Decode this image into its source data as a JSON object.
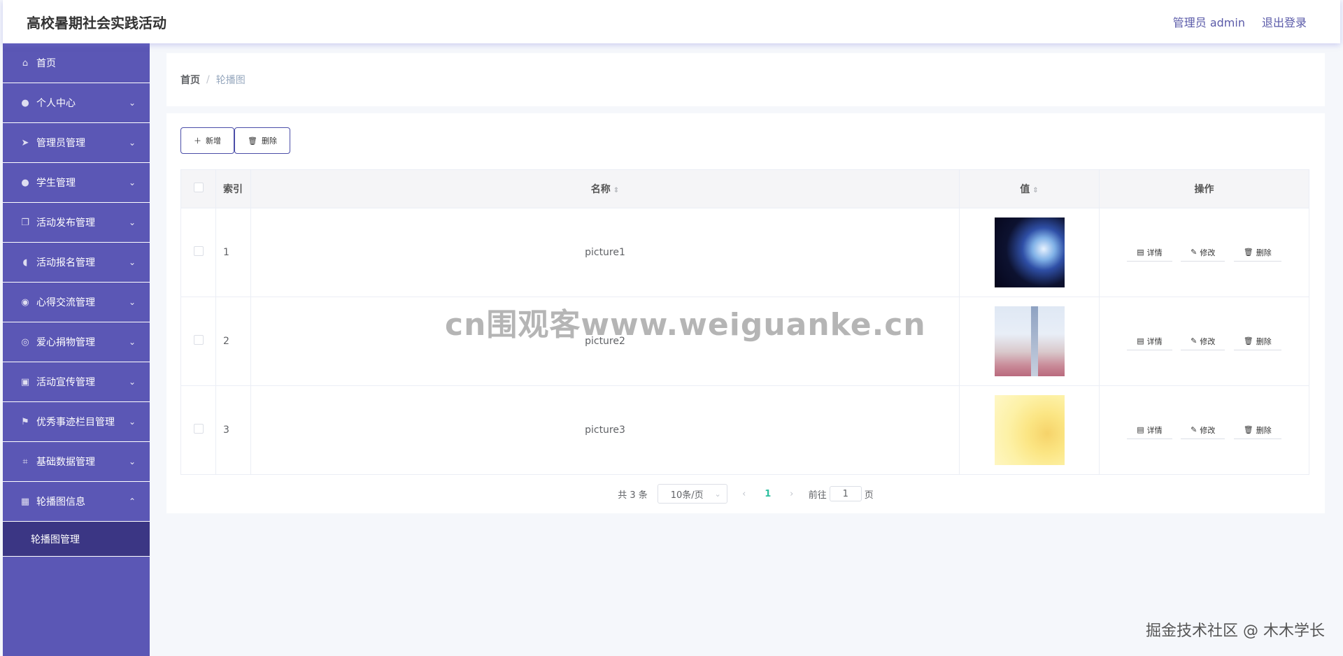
{
  "header": {
    "title": "高校暑期社会实践活动",
    "user_label": "管理员 admin",
    "logout_label": "退出登录"
  },
  "sidebar": {
    "items": [
      {
        "label": "首页",
        "icon": "home-icon"
      },
      {
        "label": "个人中心",
        "icon": "user-icon"
      },
      {
        "label": "管理员管理",
        "icon": "send-icon"
      },
      {
        "label": "学生管理",
        "icon": "user-icon"
      },
      {
        "label": "活动发布管理",
        "icon": "copy-icon"
      },
      {
        "label": "活动报名管理",
        "icon": "microphone-icon"
      },
      {
        "label": "心得交流管理",
        "icon": "location-icon"
      },
      {
        "label": "爱心捐物管理",
        "icon": "gift-icon"
      },
      {
        "label": "活动宣传管理",
        "icon": "picture-icon"
      },
      {
        "label": "优秀事迹栏目管理",
        "icon": "flag-icon"
      },
      {
        "label": "基础数据管理",
        "icon": "crop-icon"
      },
      {
        "label": "轮播图信息",
        "icon": "grid-icon"
      }
    ],
    "submenu": {
      "label": "轮播图管理"
    }
  },
  "breadcrumb": {
    "home": "首页",
    "separator": "/",
    "current": "轮播图"
  },
  "toolbar": {
    "add_label": "新增",
    "delete_label": "删除"
  },
  "table": {
    "headers": {
      "index": "索引",
      "name": "名称",
      "value": "值",
      "ops": "操作"
    },
    "rows": [
      {
        "index": "1",
        "name": "picture1"
      },
      {
        "index": "2",
        "name": "picture2"
      },
      {
        "index": "3",
        "name": "picture3"
      }
    ],
    "op_labels": {
      "detail": "详情",
      "edit": "修改",
      "delete": "删除"
    }
  },
  "pagination": {
    "total": "共 3 条",
    "page_size": "10条/页",
    "current_page": "1",
    "goto_prefix": "前往",
    "goto_value": "1",
    "goto_suffix": "页"
  },
  "watermarks": {
    "center": "cn围观客www.weiguanke.cn",
    "corner": "掘金技术社区 @ 木木学长"
  },
  "colors": {
    "sidebar": "#5b57b5",
    "sidebar_active": "#3b3684",
    "accent": "#4b4ea8",
    "page_active": "#2dbf9f"
  }
}
